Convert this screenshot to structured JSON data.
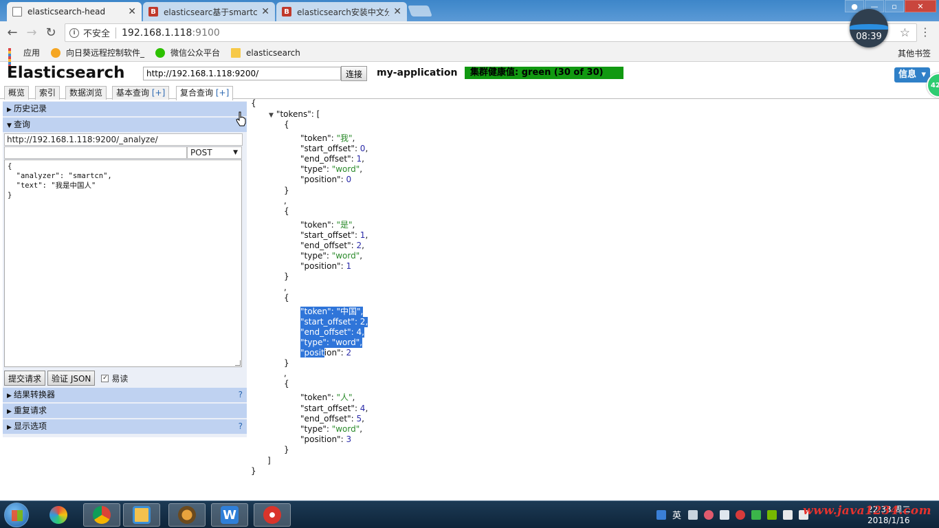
{
  "browser": {
    "tabs": [
      {
        "title": "elasticsearch-head",
        "active": true
      },
      {
        "title": "elasticsearc基于smartc",
        "active": false
      },
      {
        "title": "elasticsearch安装中文分",
        "active": false
      }
    ],
    "tab_close": "✕",
    "security_label": "不安全",
    "url_host": "192.168.1.118",
    "url_port": ":9100",
    "clock": "08:39",
    "bookmarks": [
      {
        "label": "应用",
        "icon": "apps-icon"
      },
      {
        "label": "向日葵远程控制软件_",
        "icon": "sunflower-icon"
      },
      {
        "label": "微信公众平台",
        "icon": "wechat-icon"
      },
      {
        "label": "elasticsearch",
        "icon": "folder-icon"
      }
    ],
    "other_bookmarks": "其他书签"
  },
  "es": {
    "title": "Elasticsearch",
    "connect_url": "http://192.168.1.118:9200/",
    "connect_label": "连接",
    "cluster_name": "my-application",
    "health": "集群健康值: green (30 of 30)",
    "info_label": "信息",
    "badge": "42",
    "tabs": [
      {
        "label": "概览",
        "plus": ""
      },
      {
        "label": "索引",
        "plus": ""
      },
      {
        "label": "数据浏览",
        "plus": ""
      },
      {
        "label": "基本查询 ",
        "plus": "[+]"
      },
      {
        "label": "复合查询 ",
        "plus": "[+]"
      }
    ]
  },
  "query": {
    "history_label": "历史记录",
    "query_label": "查询",
    "url": "http://192.168.1.118:9200/_analyze/",
    "path": "",
    "method": "POST",
    "body": "{\n  \"analyzer\": \"smartcn\",\n  \"text\": \"我是中国人\"\n}",
    "submit_label": "提交请求",
    "validate_label": "验证 JSON",
    "pretty_label": "易读",
    "pretty_checked": "✓",
    "transformer_label": "结果转换器",
    "repeat_label": "重复请求",
    "display_label": "显示选项",
    "help": "?"
  },
  "result": {
    "root_key": "\"tokens\"",
    "tokens": [
      {
        "token": "\"我\"",
        "start_offset": "0",
        "end_offset": "1",
        "type": "\"word\"",
        "position": "0"
      },
      {
        "token": "\"是\"",
        "start_offset": "1",
        "end_offset": "2",
        "type": "\"word\"",
        "position": "1"
      },
      {
        "token": "\"中国\"",
        "start_offset": "2",
        "end_offset": "4",
        "type": "\"word\"",
        "position": "2"
      },
      {
        "token": "\"人\"",
        "start_offset": "4",
        "end_offset": "5",
        "type": "\"word\"",
        "position": "3"
      }
    ],
    "selected_token_index": 2
  },
  "taskbar": {
    "ime": "英",
    "time": "22:33 周二",
    "date": "2018/1/16",
    "watermark": "www.java1234.com"
  }
}
